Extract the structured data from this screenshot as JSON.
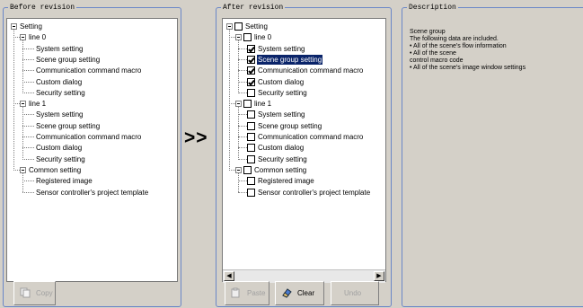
{
  "before": {
    "title": "Before revision",
    "tree": [
      {
        "label": "Setting"
      },
      {
        "label": "line 0"
      },
      {
        "label": "System setting"
      },
      {
        "label": "Scene group setting"
      },
      {
        "label": "Communication command macro"
      },
      {
        "label": "Custom dialog"
      },
      {
        "label": "Security setting"
      },
      {
        "label": "line 1"
      },
      {
        "label": "System setting"
      },
      {
        "label": "Scene group setting"
      },
      {
        "label": "Communication command macro"
      },
      {
        "label": "Custom dialog"
      },
      {
        "label": "Security setting"
      },
      {
        "label": "Common setting"
      },
      {
        "label": "Registered image"
      },
      {
        "label": "Sensor controller's project template"
      }
    ],
    "copy_button": "Copy"
  },
  "transfer_arrow": ">>",
  "after": {
    "title": "After revision",
    "tree": [
      {
        "label": "Setting",
        "checked": false
      },
      {
        "label": "line 0",
        "checked": false
      },
      {
        "label": "System setting",
        "checked": true
      },
      {
        "label": "Scene group setting",
        "checked": true,
        "selected": true
      },
      {
        "label": "Communication command macro",
        "checked": true
      },
      {
        "label": "Custom dialog",
        "checked": true
      },
      {
        "label": "Security setting",
        "checked": false
      },
      {
        "label": "line 1",
        "checked": false
      },
      {
        "label": "System setting",
        "checked": false
      },
      {
        "label": "Scene group setting",
        "checked": false
      },
      {
        "label": "Communication command macro",
        "checked": false
      },
      {
        "label": "Custom dialog",
        "checked": false
      },
      {
        "label": "Security setting",
        "checked": false
      },
      {
        "label": "Common setting",
        "checked": false
      },
      {
        "label": "Registered image",
        "checked": false
      },
      {
        "label": "Sensor controller's project template",
        "checked": false
      }
    ],
    "paste_button": "Paste",
    "clear_button": "Clear",
    "undo_button": "Undo"
  },
  "description": {
    "title": "Description",
    "lines": [
      "Scene group",
      "The following data are included.",
      "• All of the scene's flow information",
      "• All of the scene",
      "control macro code",
      "• All of the scene's image window settings"
    ]
  },
  "colors": {
    "panel_border": "#6a87c8",
    "selection": "#0a246a",
    "background": "#d4d0c8"
  }
}
